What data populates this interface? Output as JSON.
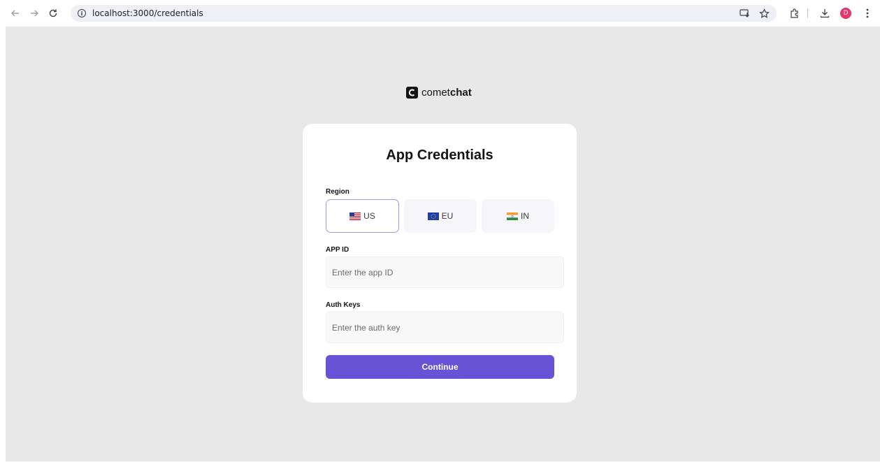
{
  "browser": {
    "url": "localhost:3000/credentials",
    "avatar_initial": "D"
  },
  "logo": {
    "text_light": "comet",
    "text_bold": "chat"
  },
  "card": {
    "title": "App Credentials",
    "region_label": "Region",
    "regions": [
      {
        "code": "US",
        "selected": true
      },
      {
        "code": "EU",
        "selected": false
      },
      {
        "code": "IN",
        "selected": false
      }
    ],
    "app_id_label": "APP ID",
    "app_id_placeholder": "Enter the app ID",
    "auth_key_label": "Auth Keys",
    "auth_key_placeholder": "Enter the auth key",
    "continue_label": "Continue"
  },
  "colors": {
    "accent": "#6852d6",
    "selected_border": "#a497e6",
    "background": "#e8e8e8",
    "avatar": "#e8336c"
  }
}
